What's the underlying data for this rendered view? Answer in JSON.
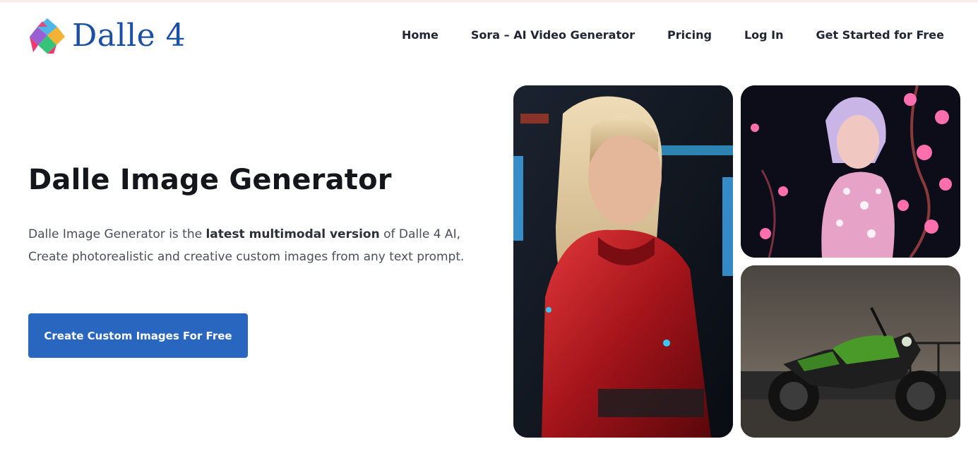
{
  "header": {
    "logo_text": "Dalle 4",
    "nav": [
      {
        "label": "Home"
      },
      {
        "label": "Sora – AI Video Generator"
      },
      {
        "label": "Pricing"
      },
      {
        "label": "Log In"
      },
      {
        "label": "Get Started for Free"
      }
    ]
  },
  "hero": {
    "title": "Dalle Image Generator",
    "desc_pre": "Dalle Image Generator is the ",
    "desc_bold": "latest multimodal version",
    "desc_post": " of Dalle 4 AI, Create photorealistic and creative custom images from any text prompt.",
    "cta_label": "Create Custom Images For Free"
  },
  "colors": {
    "accent": "#2866c0",
    "logo": "#1b4ea5",
    "heading": "#15161c"
  },
  "gallery": [
    {
      "subject": "woman in red suit"
    },
    {
      "subject": "woman with flowers"
    },
    {
      "subject": "green motorcycle"
    }
  ]
}
